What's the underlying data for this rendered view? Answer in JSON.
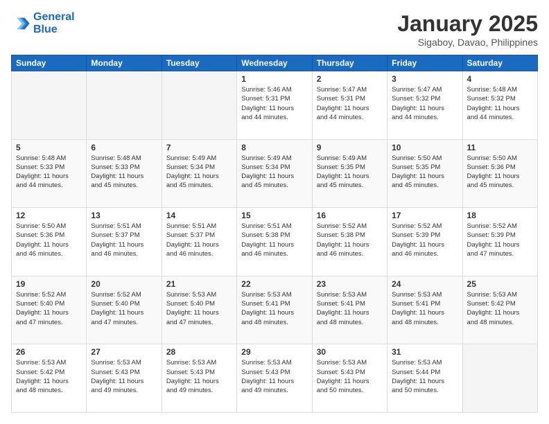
{
  "logo": {
    "line1": "General",
    "line2": "Blue"
  },
  "title": "January 2025",
  "subtitle": "Sigaboy, Davao, Philippines",
  "days_of_week": [
    "Sunday",
    "Monday",
    "Tuesday",
    "Wednesday",
    "Thursday",
    "Friday",
    "Saturday"
  ],
  "weeks": [
    [
      {
        "day": "",
        "info": ""
      },
      {
        "day": "",
        "info": ""
      },
      {
        "day": "",
        "info": ""
      },
      {
        "day": "1",
        "info": "Sunrise: 5:46 AM\nSunset: 5:31 PM\nDaylight: 11 hours\nand 44 minutes."
      },
      {
        "day": "2",
        "info": "Sunrise: 5:47 AM\nSunset: 5:31 PM\nDaylight: 11 hours\nand 44 minutes."
      },
      {
        "day": "3",
        "info": "Sunrise: 5:47 AM\nSunset: 5:32 PM\nDaylight: 11 hours\nand 44 minutes."
      },
      {
        "day": "4",
        "info": "Sunrise: 5:48 AM\nSunset: 5:32 PM\nDaylight: 11 hours\nand 44 minutes."
      }
    ],
    [
      {
        "day": "5",
        "info": "Sunrise: 5:48 AM\nSunset: 5:33 PM\nDaylight: 11 hours\nand 44 minutes."
      },
      {
        "day": "6",
        "info": "Sunrise: 5:48 AM\nSunset: 5:33 PM\nDaylight: 11 hours\nand 45 minutes."
      },
      {
        "day": "7",
        "info": "Sunrise: 5:49 AM\nSunset: 5:34 PM\nDaylight: 11 hours\nand 45 minutes."
      },
      {
        "day": "8",
        "info": "Sunrise: 5:49 AM\nSunset: 5:34 PM\nDaylight: 11 hours\nand 45 minutes."
      },
      {
        "day": "9",
        "info": "Sunrise: 5:49 AM\nSunset: 5:35 PM\nDaylight: 11 hours\nand 45 minutes."
      },
      {
        "day": "10",
        "info": "Sunrise: 5:50 AM\nSunset: 5:35 PM\nDaylight: 11 hours\nand 45 minutes."
      },
      {
        "day": "11",
        "info": "Sunrise: 5:50 AM\nSunset: 5:36 PM\nDaylight: 11 hours\nand 45 minutes."
      }
    ],
    [
      {
        "day": "12",
        "info": "Sunrise: 5:50 AM\nSunset: 5:36 PM\nDaylight: 11 hours\nand 46 minutes."
      },
      {
        "day": "13",
        "info": "Sunrise: 5:51 AM\nSunset: 5:37 PM\nDaylight: 11 hours\nand 46 minutes."
      },
      {
        "day": "14",
        "info": "Sunrise: 5:51 AM\nSunset: 5:37 PM\nDaylight: 11 hours\nand 46 minutes."
      },
      {
        "day": "15",
        "info": "Sunrise: 5:51 AM\nSunset: 5:38 PM\nDaylight: 11 hours\nand 46 minutes."
      },
      {
        "day": "16",
        "info": "Sunrise: 5:52 AM\nSunset: 5:38 PM\nDaylight: 11 hours\nand 46 minutes."
      },
      {
        "day": "17",
        "info": "Sunrise: 5:52 AM\nSunset: 5:39 PM\nDaylight: 11 hours\nand 46 minutes."
      },
      {
        "day": "18",
        "info": "Sunrise: 5:52 AM\nSunset: 5:39 PM\nDaylight: 11 hours\nand 47 minutes."
      }
    ],
    [
      {
        "day": "19",
        "info": "Sunrise: 5:52 AM\nSunset: 5:40 PM\nDaylight: 11 hours\nand 47 minutes."
      },
      {
        "day": "20",
        "info": "Sunrise: 5:52 AM\nSunset: 5:40 PM\nDaylight: 11 hours\nand 47 minutes."
      },
      {
        "day": "21",
        "info": "Sunrise: 5:53 AM\nSunset: 5:40 PM\nDaylight: 11 hours\nand 47 minutes."
      },
      {
        "day": "22",
        "info": "Sunrise: 5:53 AM\nSunset: 5:41 PM\nDaylight: 11 hours\nand 48 minutes."
      },
      {
        "day": "23",
        "info": "Sunrise: 5:53 AM\nSunset: 5:41 PM\nDaylight: 11 hours\nand 48 minutes."
      },
      {
        "day": "24",
        "info": "Sunrise: 5:53 AM\nSunset: 5:41 PM\nDaylight: 11 hours\nand 48 minutes."
      },
      {
        "day": "25",
        "info": "Sunrise: 5:53 AM\nSunset: 5:42 PM\nDaylight: 11 hours\nand 48 minutes."
      }
    ],
    [
      {
        "day": "26",
        "info": "Sunrise: 5:53 AM\nSunset: 5:42 PM\nDaylight: 11 hours\nand 48 minutes."
      },
      {
        "day": "27",
        "info": "Sunrise: 5:53 AM\nSunset: 5:43 PM\nDaylight: 11 hours\nand 49 minutes."
      },
      {
        "day": "28",
        "info": "Sunrise: 5:53 AM\nSunset: 5:43 PM\nDaylight: 11 hours\nand 49 minutes."
      },
      {
        "day": "29",
        "info": "Sunrise: 5:53 AM\nSunset: 5:43 PM\nDaylight: 11 hours\nand 49 minutes."
      },
      {
        "day": "30",
        "info": "Sunrise: 5:53 AM\nSunset: 5:43 PM\nDaylight: 11 hours\nand 50 minutes."
      },
      {
        "day": "31",
        "info": "Sunrise: 5:53 AM\nSunset: 5:44 PM\nDaylight: 11 hours\nand 50 minutes."
      },
      {
        "day": "",
        "info": ""
      }
    ]
  ]
}
